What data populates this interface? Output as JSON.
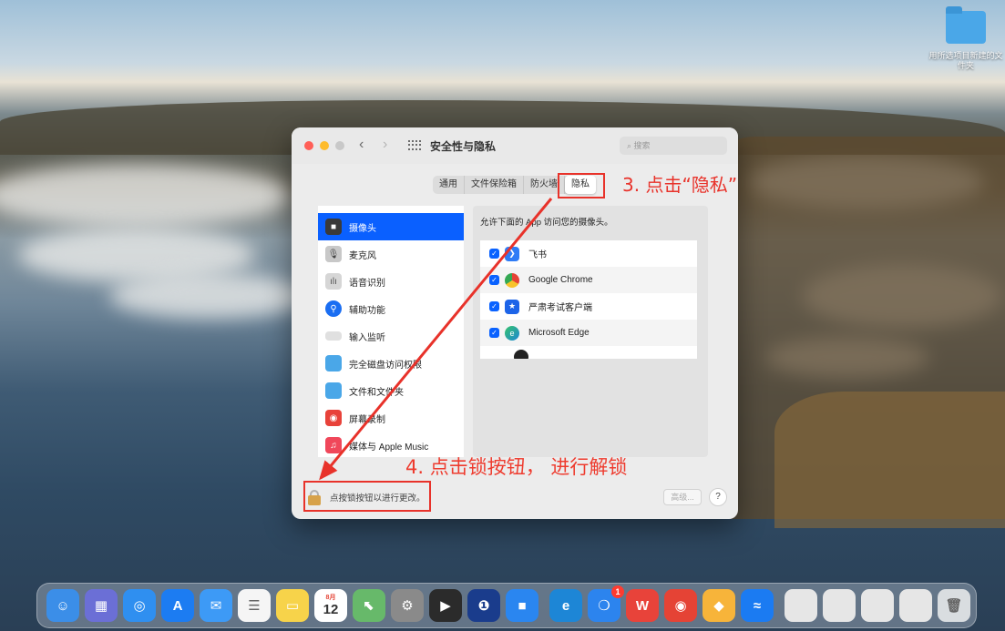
{
  "desktop": {
    "folder_label": "用所选项目新建的文件夹"
  },
  "window": {
    "title": "安全性与隐私",
    "search_placeholder": "搜索",
    "tabs": [
      {
        "label": "通用"
      },
      {
        "label": "文件保险箱"
      },
      {
        "label": "防火墙"
      },
      {
        "label": "隐私",
        "active": true
      }
    ],
    "sidebar": {
      "items": [
        {
          "label": "摄像头",
          "icon": "camera-icon",
          "selected": true
        },
        {
          "label": "麦克风",
          "icon": "microphone-icon"
        },
        {
          "label": "语音识别",
          "icon": "speech-recognition-icon"
        },
        {
          "label": "辅助功能",
          "icon": "accessibility-icon"
        },
        {
          "label": "输入监听",
          "icon": "keyboard-icon"
        },
        {
          "label": "完全磁盘访问权限",
          "icon": "folder-icon"
        },
        {
          "label": "文件和文件夹",
          "icon": "folder-icon"
        },
        {
          "label": "屏幕录制",
          "icon": "screen-recording-icon"
        },
        {
          "label": "媒体与 Apple Music",
          "icon": "music-icon"
        }
      ]
    },
    "pane": {
      "description": "允许下面的 App 访问您的摄像头。",
      "apps": [
        {
          "name": "飞书",
          "checked": true,
          "icon": "feishu-icon"
        },
        {
          "name": "Google Chrome",
          "checked": true,
          "icon": "chrome-icon"
        },
        {
          "name": "严肃考试客户端",
          "checked": true,
          "icon": "exam-client-icon"
        },
        {
          "name": "Microsoft Edge",
          "checked": true,
          "icon": "edge-icon"
        }
      ]
    },
    "footer": {
      "lock_text": "点按锁按钮以进行更改。",
      "advanced_label": "高级...",
      "help_label": "?"
    }
  },
  "annotations": {
    "step3": "3. 点击“隐私”",
    "step4": "4. 点击锁按钮， 进行解锁",
    "color": "#e8322a"
  },
  "dock": {
    "items": [
      {
        "name": "finder-icon",
        "color": "#3b8ee8"
      },
      {
        "name": "launchpad-icon",
        "color": "#6b6fd6"
      },
      {
        "name": "safari-icon",
        "color": "#2f8ff0"
      },
      {
        "name": "app-store-icon",
        "color": "#1c7cf2"
      },
      {
        "name": "mail-icon",
        "color": "#3d9af6"
      },
      {
        "name": "reminders-icon",
        "color": "#f5f5f5"
      },
      {
        "name": "notes-icon",
        "color": "#f7d34a"
      },
      {
        "name": "calendar-icon",
        "color": "#ffffff",
        "month": "8月",
        "day": "12"
      },
      {
        "name": "maps-icon",
        "color": "#67b96a"
      },
      {
        "name": "system-preferences-icon",
        "color": "#8a8a8a"
      },
      {
        "name": "final-cut-icon",
        "color": "#2b2b2b"
      },
      {
        "name": "onepassword-icon",
        "color": "#1a3c8c"
      },
      {
        "name": "feishu-dock-icon",
        "color": "#2a86f0"
      },
      {
        "name": "edge-dock-icon",
        "color": "#1d86d6"
      },
      {
        "name": "qq-icon",
        "color": "#2c84ee",
        "badge": "1"
      },
      {
        "name": "wps-icon",
        "color": "#e8433a"
      },
      {
        "name": "chrome-dock-icon",
        "color": "#e54335"
      },
      {
        "name": "sketch-icon",
        "color": "#f7b43a"
      },
      {
        "name": "lark-icon",
        "color": "#1b7bf2"
      },
      {
        "name": "recent-doc-1-icon",
        "color": "#e6e6e6"
      },
      {
        "name": "recent-doc-2-icon",
        "color": "#e6e6e6"
      },
      {
        "name": "recent-doc-3-icon",
        "color": "#e6e6e6"
      },
      {
        "name": "recent-doc-4-icon",
        "color": "#e6e6e6"
      },
      {
        "name": "trash-icon",
        "color": "#d9dde0"
      }
    ]
  }
}
